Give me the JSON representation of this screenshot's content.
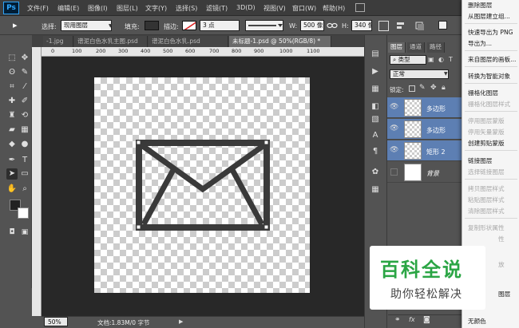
{
  "app": {
    "logo": "Ps"
  },
  "menubar": [
    "文件(F)",
    "编辑(E)",
    "图像(I)",
    "图层(L)",
    "文字(Y)",
    "选择(S)",
    "滤镜(T)",
    "3D(D)",
    "视图(V)",
    "窗口(W)",
    "帮助(H)"
  ],
  "options": {
    "select_label": "选择:",
    "select_value": "现用图层",
    "fill_label": "填充:",
    "stroke_label": "描边:",
    "stroke_size": "3 点",
    "w_label": "W:",
    "w_value": "500 像",
    "h_label": "H:",
    "h_value": "340 像",
    "link_icon": "link-icon"
  },
  "tabs": [
    {
      "label": "-1.jpg"
    },
    {
      "label": "谱泥白色水乳主图.psd"
    },
    {
      "label": "谱泥白色水乳.psd"
    },
    {
      "label": "未标题-1.psd @ 50%(RGB/8) *",
      "active": true
    }
  ],
  "ruler": {
    "h_labels": [
      "0",
      "100",
      "200",
      "300",
      "400",
      "500",
      "600",
      "700",
      "800",
      "900",
      "1000",
      "1100"
    ]
  },
  "status": {
    "zoom": "50%",
    "doc_info": "文档:1.83M/0 字节"
  },
  "layers_panel": {
    "tabs": [
      "图层",
      "通道",
      "路径"
    ],
    "filter_kind": "类型",
    "blend_mode": "正常",
    "lock_label": "锁定:",
    "layers": [
      {
        "name": "多边形",
        "selected": true,
        "visible": true
      },
      {
        "name": "多边形",
        "selected": true,
        "visible": true
      },
      {
        "name": "矩形 2",
        "selected": true,
        "visible": true
      },
      {
        "name": "背景",
        "selected": false,
        "visible": false
      }
    ]
  },
  "context_menu": {
    "items": [
      {
        "label": "删除图层",
        "enabled": true
      },
      {
        "label": "从图层建立组...",
        "enabled": true
      },
      {
        "label": "快速导出为 PNG",
        "enabled": true
      },
      {
        "label": "导出为...",
        "enabled": true
      },
      {
        "label": "来自图层的画板...",
        "enabled": true
      },
      {
        "label": "转换为智能对象",
        "enabled": true
      },
      {
        "label": "栅格化图层",
        "enabled": true
      },
      {
        "label": "栅格化图层样式",
        "enabled": false
      },
      {
        "label": "停用图层蒙版",
        "enabled": false
      },
      {
        "label": "停用矢量蒙版",
        "enabled": false
      },
      {
        "label": "创建剪贴蒙版",
        "enabled": true
      },
      {
        "label": "链接图层",
        "enabled": true
      },
      {
        "label": "选择链接图层",
        "enabled": false
      },
      {
        "label": "拷贝图层样式",
        "enabled": false
      },
      {
        "label": "粘贴图层样式",
        "enabled": false
      },
      {
        "label": "清除图层样式",
        "enabled": false
      },
      {
        "label": "复制形状属性",
        "enabled": false
      },
      {
        "label": "性",
        "enabled": false
      },
      {
        "label": "放",
        "enabled": false
      },
      {
        "label": "图层",
        "enabled": true
      },
      {
        "label": "无颜色",
        "enabled": true
      }
    ]
  },
  "watermark": {
    "title": "百科全说",
    "subtitle": "助你轻松解决"
  }
}
